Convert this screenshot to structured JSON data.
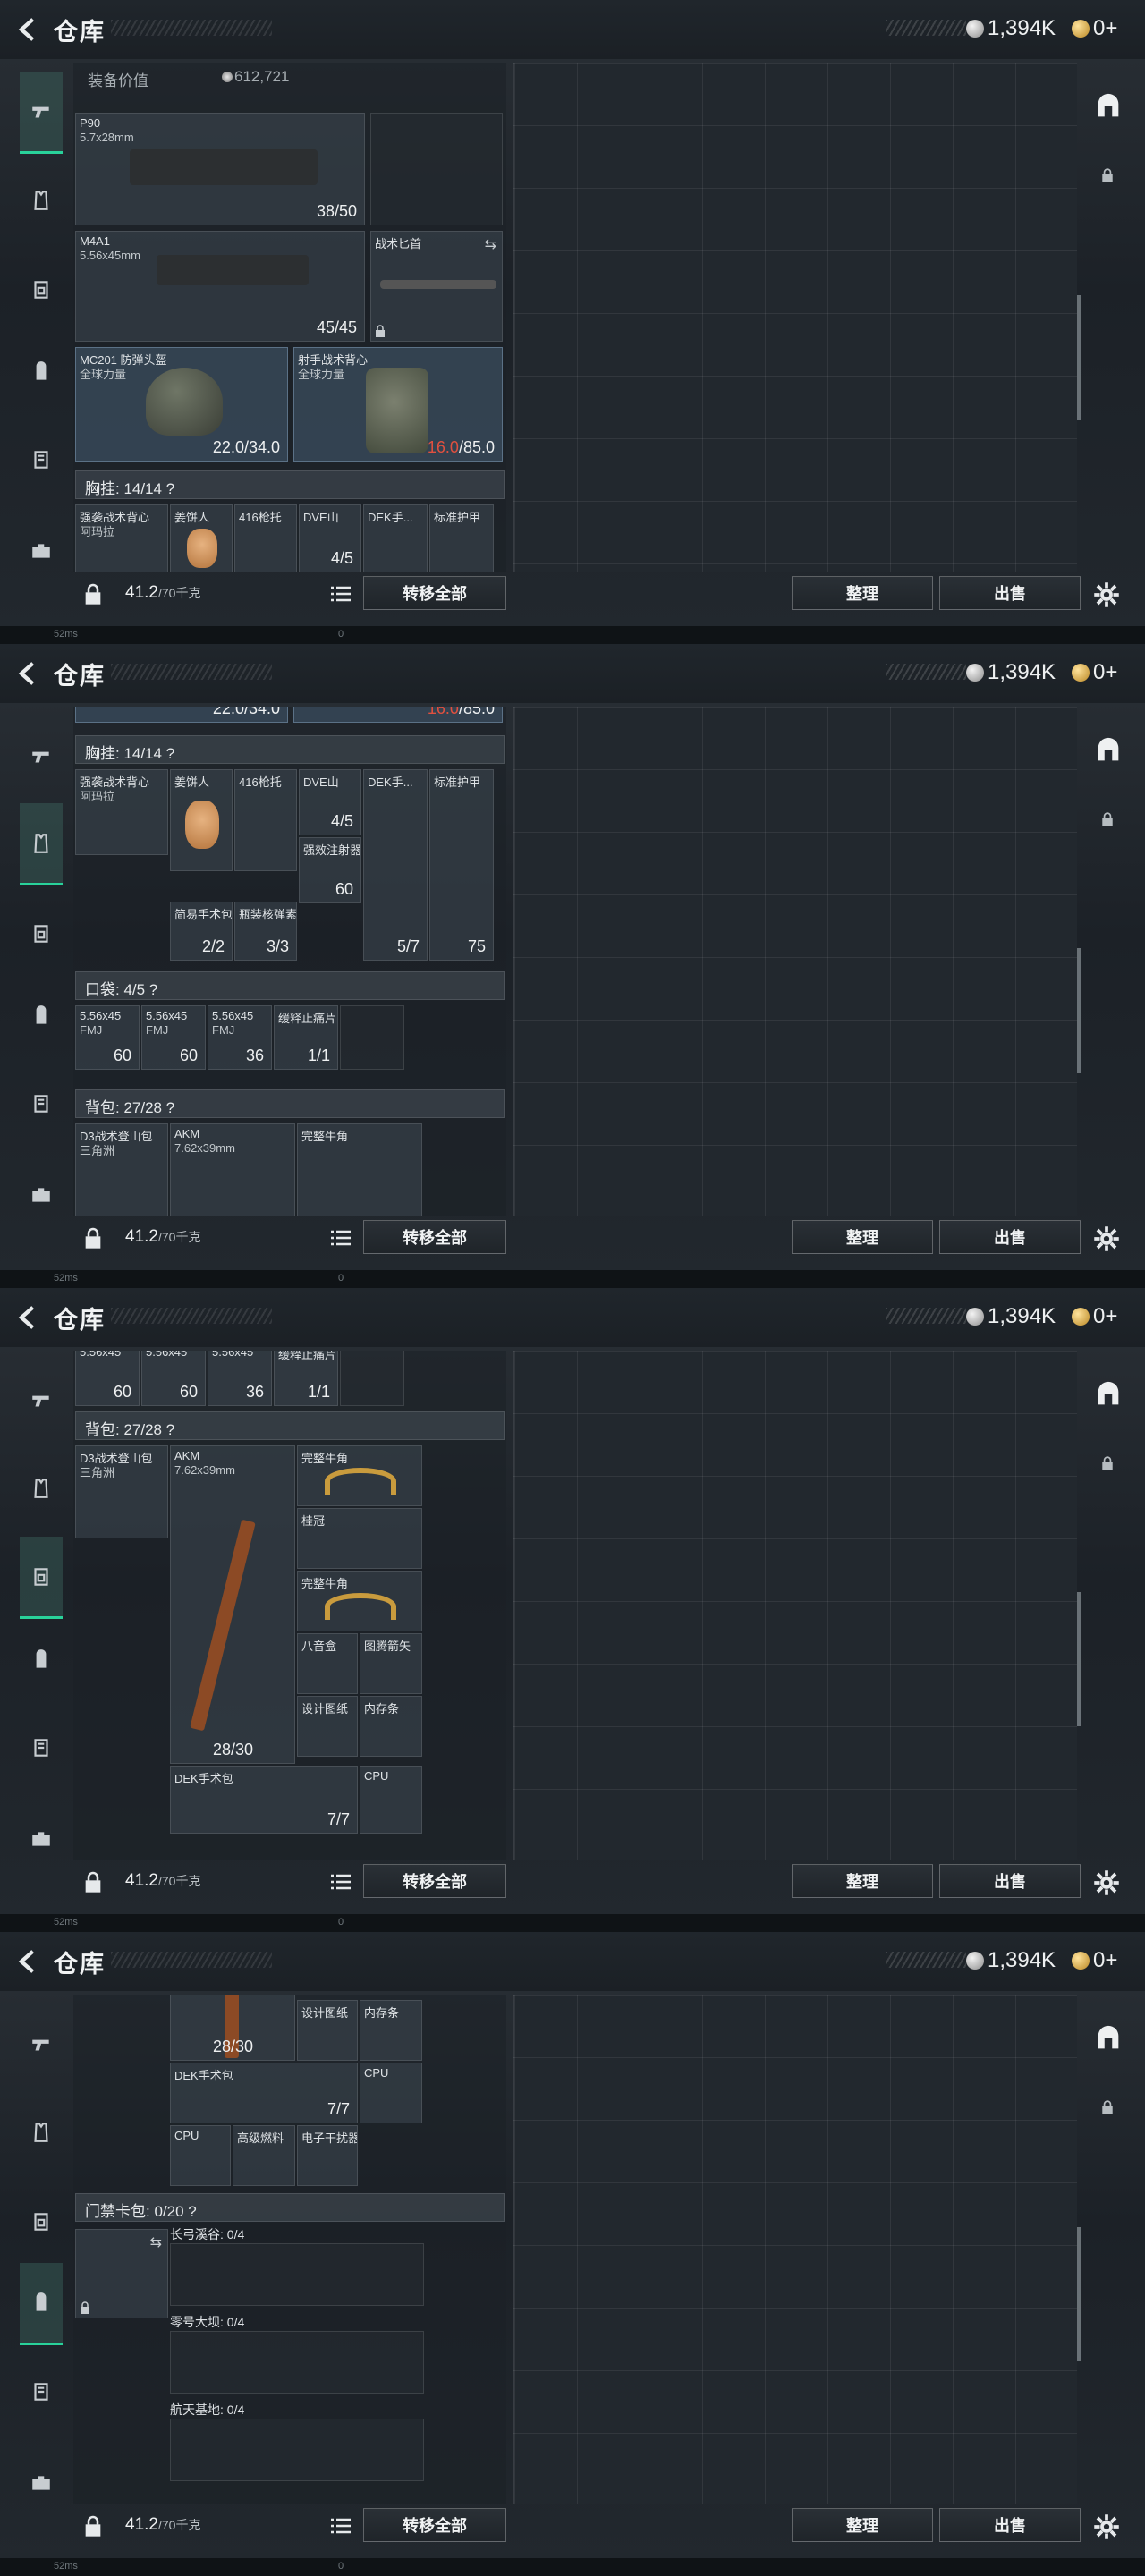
{
  "header": {
    "title": "仓库",
    "silver": "1,394K",
    "gold": "0+"
  },
  "gear_value": {
    "label": "装备价值",
    "value": "612,721"
  },
  "items": {
    "p90": {
      "name": "P90",
      "ammo": "5.7x28mm",
      "count": "38/50"
    },
    "m4a1": {
      "name": "M4A1",
      "ammo": "5.56x45mm",
      "count": "45/45"
    },
    "knife": {
      "name": "战术匕首"
    },
    "helmet": {
      "name": "MC201 防弹头盔",
      "sub": "全球力量",
      "count": "22.0/34.0"
    },
    "armor": {
      "name": "射手战术背心",
      "sub": "全球力量",
      "count_red": "16.0",
      "count_rest": "/85.0"
    },
    "rig": {
      "name": "强袭战术背心",
      "sub": "阿玛拉"
    },
    "gingerbread": {
      "name": "姜饼人"
    },
    "grip": {
      "name": "416枪托"
    },
    "dve": {
      "name": "DVE山",
      "count": "4/5"
    },
    "dek_mag": {
      "name": "DEK手...",
      "count": "5/7"
    },
    "std_armor": {
      "name": "标准护甲",
      "count": "75"
    },
    "inject": {
      "name": "强效注射器",
      "count": "60"
    },
    "medkit": {
      "name": "简易手术包",
      "count": "2/2"
    },
    "bottle": {
      "name": "瓶装核弹素",
      "count": "3/3"
    },
    "ammo1": {
      "name": "5.56x45",
      "sub": "FMJ",
      "count": "60"
    },
    "ammo2": {
      "name": "5.56x45",
      "sub": "FMJ",
      "count": "60"
    },
    "ammo3": {
      "name": "5.56x45",
      "sub": "FMJ",
      "count": "36"
    },
    "tablet": {
      "name": "缓释止痛片",
      "count": "1/1"
    },
    "bag": {
      "name": "D3战术登山包",
      "sub": "三角洲"
    },
    "akm": {
      "name": "AKM",
      "ammo": "7.62x39mm",
      "count": "28/30"
    },
    "horn": {
      "name": "完整牛角"
    },
    "crown": {
      "name": "桂冠"
    },
    "octo": {
      "name": "八音盒"
    },
    "arrow": {
      "name": "图腾箭矢"
    },
    "blueprint": {
      "name": "设计图纸"
    },
    "memory": {
      "name": "内存条"
    },
    "dek_kit": {
      "name": "DEK手术包",
      "count": "7/7"
    },
    "cpu": {
      "name": "CPU"
    },
    "fuel": {
      "name": "高级燃料"
    },
    "jammer": {
      "name": "电子干扰器"
    }
  },
  "sections": {
    "chest": "胸挂: 14/14 ?",
    "pocket": "口袋: 4/5 ?",
    "backpack": "背包: 27/28 ?",
    "keycard": "门禁卡包: 0/20 ?"
  },
  "keycard_maps": [
    "长弓溪谷: 0/4",
    "零号大坝: 0/4",
    "航天基地: 0/4"
  ],
  "bottom": {
    "weight": "41.2",
    "weight_max": "/70千克",
    "transfer": "转移全部",
    "sort": "整理",
    "sell": "出售"
  },
  "status": {
    "ping": "52ms",
    "num": "0"
  }
}
